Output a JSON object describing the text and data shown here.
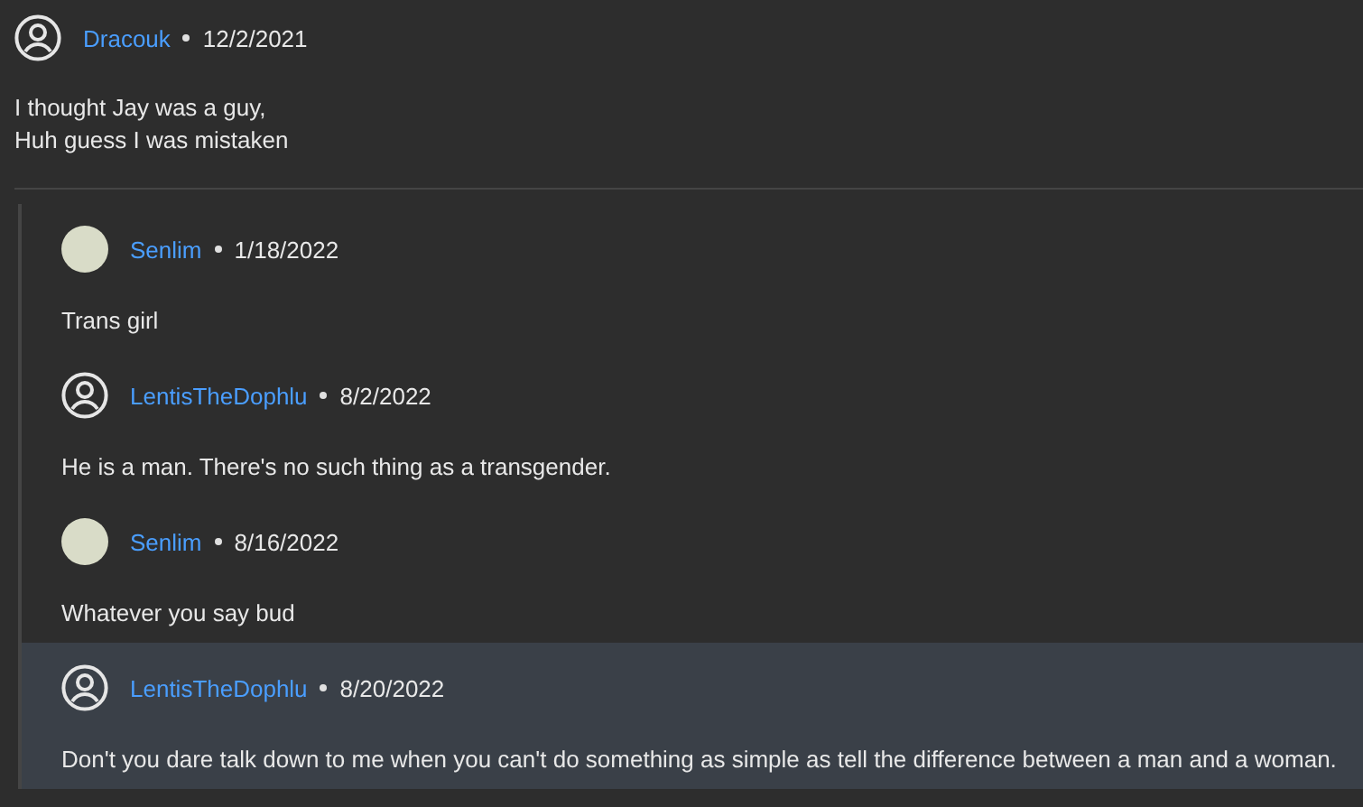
{
  "comment": {
    "author": "Dracouk",
    "date": "12/2/2021",
    "lines": [
      "I thought Jay was a guy,",
      "Huh guess I was mistaken"
    ]
  },
  "replies": [
    {
      "kind": "picture-avatar",
      "author": "Senlim",
      "date": "1/18/2022",
      "text": "Trans girl",
      "highlighted": false
    },
    {
      "kind": "default-avatar",
      "author": "LentisTheDophlu",
      "date": "8/2/2022",
      "text": "He is a man. There's no such thing as a transgender.",
      "highlighted": false
    },
    {
      "kind": "picture-avatar",
      "author": "Senlim",
      "date": "8/16/2022",
      "text": "Whatever you say bud",
      "highlighted": false
    },
    {
      "kind": "default-avatar",
      "author": "LentisTheDophlu",
      "date": "8/20/2022",
      "text": "Don't you dare talk down to me when you can't do something as simple as tell the difference between a man and a woman.",
      "highlighted": true
    }
  ]
}
